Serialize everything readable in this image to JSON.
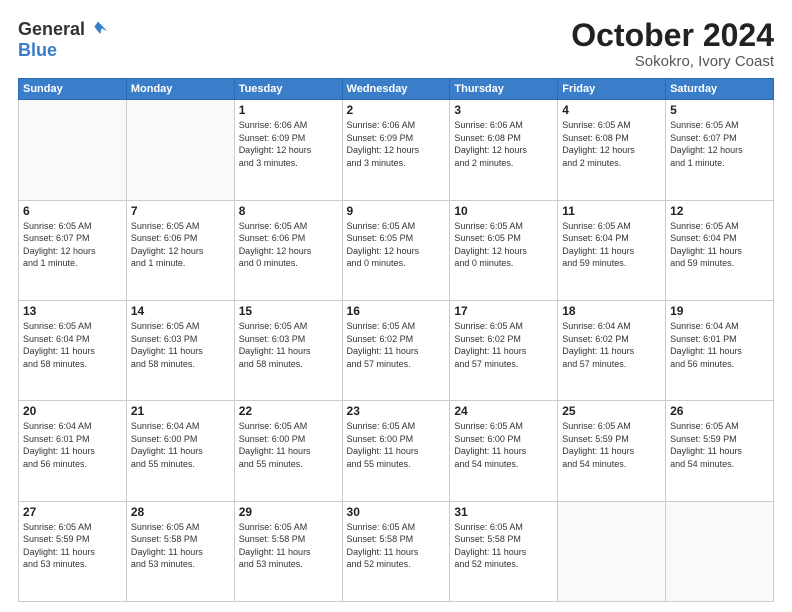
{
  "header": {
    "logo_general": "General",
    "logo_blue": "Blue",
    "month_title": "October 2024",
    "location": "Sokokro, Ivory Coast"
  },
  "weekdays": [
    "Sunday",
    "Monday",
    "Tuesday",
    "Wednesday",
    "Thursday",
    "Friday",
    "Saturday"
  ],
  "weeks": [
    [
      {
        "day": "",
        "info": ""
      },
      {
        "day": "",
        "info": ""
      },
      {
        "day": "1",
        "info": "Sunrise: 6:06 AM\nSunset: 6:09 PM\nDaylight: 12 hours\nand 3 minutes."
      },
      {
        "day": "2",
        "info": "Sunrise: 6:06 AM\nSunset: 6:09 PM\nDaylight: 12 hours\nand 3 minutes."
      },
      {
        "day": "3",
        "info": "Sunrise: 6:06 AM\nSunset: 6:08 PM\nDaylight: 12 hours\nand 2 minutes."
      },
      {
        "day": "4",
        "info": "Sunrise: 6:05 AM\nSunset: 6:08 PM\nDaylight: 12 hours\nand 2 minutes."
      },
      {
        "day": "5",
        "info": "Sunrise: 6:05 AM\nSunset: 6:07 PM\nDaylight: 12 hours\nand 1 minute."
      }
    ],
    [
      {
        "day": "6",
        "info": "Sunrise: 6:05 AM\nSunset: 6:07 PM\nDaylight: 12 hours\nand 1 minute."
      },
      {
        "day": "7",
        "info": "Sunrise: 6:05 AM\nSunset: 6:06 PM\nDaylight: 12 hours\nand 1 minute."
      },
      {
        "day": "8",
        "info": "Sunrise: 6:05 AM\nSunset: 6:06 PM\nDaylight: 12 hours\nand 0 minutes."
      },
      {
        "day": "9",
        "info": "Sunrise: 6:05 AM\nSunset: 6:05 PM\nDaylight: 12 hours\nand 0 minutes."
      },
      {
        "day": "10",
        "info": "Sunrise: 6:05 AM\nSunset: 6:05 PM\nDaylight: 12 hours\nand 0 minutes."
      },
      {
        "day": "11",
        "info": "Sunrise: 6:05 AM\nSunset: 6:04 PM\nDaylight: 11 hours\nand 59 minutes."
      },
      {
        "day": "12",
        "info": "Sunrise: 6:05 AM\nSunset: 6:04 PM\nDaylight: 11 hours\nand 59 minutes."
      }
    ],
    [
      {
        "day": "13",
        "info": "Sunrise: 6:05 AM\nSunset: 6:04 PM\nDaylight: 11 hours\nand 58 minutes."
      },
      {
        "day": "14",
        "info": "Sunrise: 6:05 AM\nSunset: 6:03 PM\nDaylight: 11 hours\nand 58 minutes."
      },
      {
        "day": "15",
        "info": "Sunrise: 6:05 AM\nSunset: 6:03 PM\nDaylight: 11 hours\nand 58 minutes."
      },
      {
        "day": "16",
        "info": "Sunrise: 6:05 AM\nSunset: 6:02 PM\nDaylight: 11 hours\nand 57 minutes."
      },
      {
        "day": "17",
        "info": "Sunrise: 6:05 AM\nSunset: 6:02 PM\nDaylight: 11 hours\nand 57 minutes."
      },
      {
        "day": "18",
        "info": "Sunrise: 6:04 AM\nSunset: 6:02 PM\nDaylight: 11 hours\nand 57 minutes."
      },
      {
        "day": "19",
        "info": "Sunrise: 6:04 AM\nSunset: 6:01 PM\nDaylight: 11 hours\nand 56 minutes."
      }
    ],
    [
      {
        "day": "20",
        "info": "Sunrise: 6:04 AM\nSunset: 6:01 PM\nDaylight: 11 hours\nand 56 minutes."
      },
      {
        "day": "21",
        "info": "Sunrise: 6:04 AM\nSunset: 6:00 PM\nDaylight: 11 hours\nand 55 minutes."
      },
      {
        "day": "22",
        "info": "Sunrise: 6:05 AM\nSunset: 6:00 PM\nDaylight: 11 hours\nand 55 minutes."
      },
      {
        "day": "23",
        "info": "Sunrise: 6:05 AM\nSunset: 6:00 PM\nDaylight: 11 hours\nand 55 minutes."
      },
      {
        "day": "24",
        "info": "Sunrise: 6:05 AM\nSunset: 6:00 PM\nDaylight: 11 hours\nand 54 minutes."
      },
      {
        "day": "25",
        "info": "Sunrise: 6:05 AM\nSunset: 5:59 PM\nDaylight: 11 hours\nand 54 minutes."
      },
      {
        "day": "26",
        "info": "Sunrise: 6:05 AM\nSunset: 5:59 PM\nDaylight: 11 hours\nand 54 minutes."
      }
    ],
    [
      {
        "day": "27",
        "info": "Sunrise: 6:05 AM\nSunset: 5:59 PM\nDaylight: 11 hours\nand 53 minutes."
      },
      {
        "day": "28",
        "info": "Sunrise: 6:05 AM\nSunset: 5:58 PM\nDaylight: 11 hours\nand 53 minutes."
      },
      {
        "day": "29",
        "info": "Sunrise: 6:05 AM\nSunset: 5:58 PM\nDaylight: 11 hours\nand 53 minutes."
      },
      {
        "day": "30",
        "info": "Sunrise: 6:05 AM\nSunset: 5:58 PM\nDaylight: 11 hours\nand 52 minutes."
      },
      {
        "day": "31",
        "info": "Sunrise: 6:05 AM\nSunset: 5:58 PM\nDaylight: 11 hours\nand 52 minutes."
      },
      {
        "day": "",
        "info": ""
      },
      {
        "day": "",
        "info": ""
      }
    ]
  ]
}
